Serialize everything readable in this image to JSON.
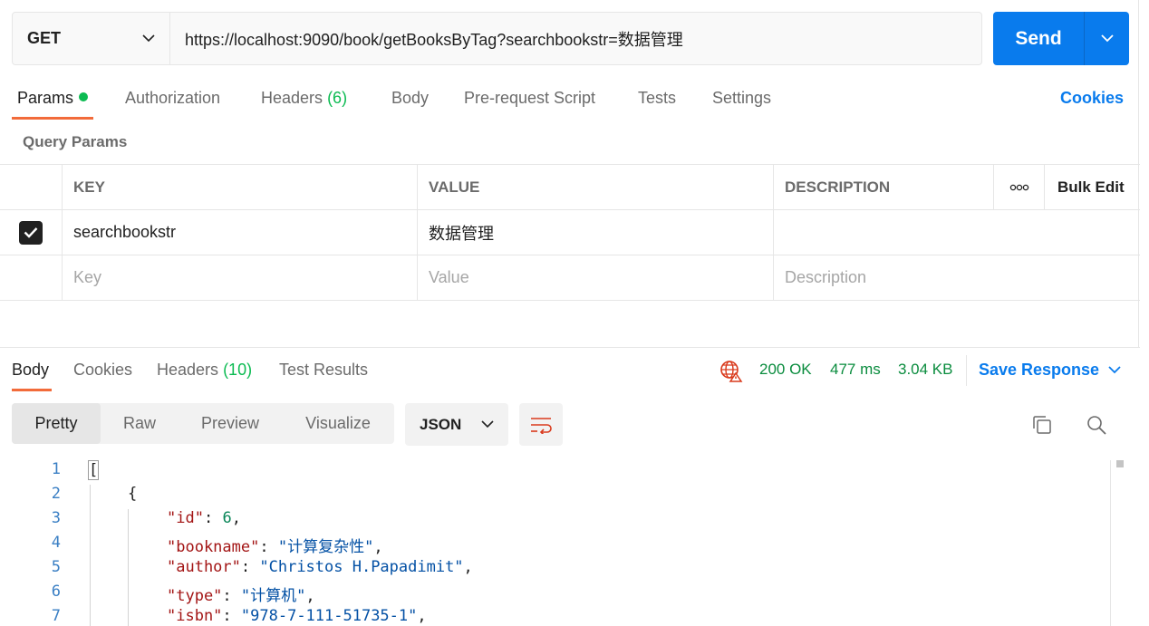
{
  "request": {
    "method": "GET",
    "url": "https://localhost:9090/book/getBooksByTag?searchbookstr=数据管理",
    "send_label": "Send"
  },
  "request_tabs": {
    "params": "Params",
    "authorization": "Authorization",
    "headers": "Headers",
    "headers_count": "(6)",
    "body": "Body",
    "prerequest": "Pre-request Script",
    "tests": "Tests",
    "settings": "Settings",
    "cookies": "Cookies"
  },
  "query_params": {
    "title": "Query Params",
    "headers": {
      "key": "KEY",
      "value": "VALUE",
      "description": "DESCRIPTION",
      "more": "∘∘∘",
      "bulk_edit": "Bulk Edit"
    },
    "rows": [
      {
        "key": "searchbookstr",
        "value": "数据管理",
        "description": "",
        "checked": true
      }
    ],
    "placeholders": {
      "key": "Key",
      "value": "Value",
      "description": "Description"
    }
  },
  "response_tabs": {
    "body": "Body",
    "cookies": "Cookies",
    "headers": "Headers",
    "headers_count": "(10)",
    "test_results": "Test Results"
  },
  "response_status": {
    "status": "200 OK",
    "time": "477 ms",
    "size": "3.04 KB",
    "save_response": "Save Response"
  },
  "view_modes": {
    "pretty": "Pretty",
    "raw": "Raw",
    "preview": "Preview",
    "visualize": "Visualize"
  },
  "format": "JSON",
  "code_lines": {
    "l1": "1",
    "l2": "2",
    "l3": "3",
    "l4": "4",
    "l5": "5",
    "l6": "6",
    "l7": "7",
    "bracket": "[",
    "brace": "{",
    "k_id": "\"id\"",
    "v_id": "6",
    "k_bookname": "\"bookname\"",
    "v_bookname": "\"计算复杂性\"",
    "k_author": "\"author\"",
    "v_author": "\"Christos H.Papadimit\"",
    "k_type": "\"type\"",
    "v_type": "\"计算机\"",
    "k_isbn": "\"isbn\"",
    "v_isbn": "\"978-7-111-51735-1\""
  },
  "colors": {
    "accent": "#097bed",
    "tab_underline": "#f26b3a",
    "success": "#0cbb52"
  }
}
